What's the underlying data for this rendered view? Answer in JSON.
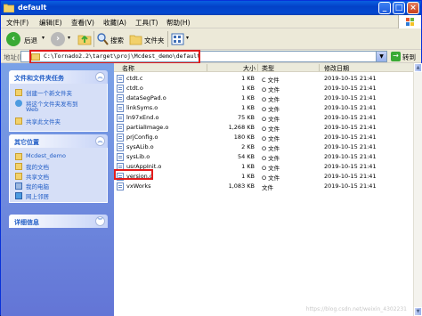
{
  "window": {
    "title": "default"
  },
  "menu": [
    "文件(F)",
    "编辑(E)",
    "查看(V)",
    "收藏(A)",
    "工具(T)",
    "帮助(H)"
  ],
  "toolbar": {
    "back": "后退",
    "search": "搜索",
    "folders": "文件夹"
  },
  "address": {
    "label": "地址(D)",
    "path": "C:\\Tornado2.2\\target\\proj\\Mcdest_demo\\default",
    "go": "转到"
  },
  "tasks": {
    "file_tasks": {
      "header": "文件和文件夹任务",
      "items": [
        "创建一个新文件夹",
        "将这个文件夹发布到",
        "Web",
        "共享此文件夹"
      ]
    },
    "other_places": {
      "header": "其它位置",
      "items": [
        "Mcdest_demo",
        "我的文档",
        "共享文档",
        "我的电脑",
        "网上邻居"
      ]
    },
    "details": {
      "header": "详细信息"
    }
  },
  "columns": {
    "name": "名称",
    "size": "大小",
    "type": "类型",
    "modified": "修改日期"
  },
  "files": [
    {
      "name": "ctdt.c",
      "size": "1 KB",
      "type": "C 文件",
      "modified": "2019-10-15 21:41"
    },
    {
      "name": "ctdt.o",
      "size": "1 KB",
      "type": "O 文件",
      "modified": "2019-10-15 21:41"
    },
    {
      "name": "dataSegPad.o",
      "size": "1 KB",
      "type": "O 文件",
      "modified": "2019-10-15 21:41"
    },
    {
      "name": "linkSyms.o",
      "size": "1 KB",
      "type": "O 文件",
      "modified": "2019-10-15 21:41"
    },
    {
      "name": "ln97xEnd.o",
      "size": "75 KB",
      "type": "O 文件",
      "modified": "2019-10-15 21:41"
    },
    {
      "name": "partialImage.o",
      "size": "1,268 KB",
      "type": "O 文件",
      "modified": "2019-10-15 21:41"
    },
    {
      "name": "prjConfig.o",
      "size": "180 KB",
      "type": "O 文件",
      "modified": "2019-10-15 21:41"
    },
    {
      "name": "sysALib.o",
      "size": "2 KB",
      "type": "O 文件",
      "modified": "2019-10-15 21:41"
    },
    {
      "name": "sysLib.o",
      "size": "54 KB",
      "type": "O 文件",
      "modified": "2019-10-15 21:41"
    },
    {
      "name": "usrAppInit.o",
      "size": "1 KB",
      "type": "O 文件",
      "modified": "2019-10-15 21:41"
    },
    {
      "name": "version.o",
      "size": "1 KB",
      "type": "O 文件",
      "modified": "2019-10-15 21:41"
    },
    {
      "name": "vxWorks",
      "size": "1,083 KB",
      "type": "文件",
      "modified": "2019-10-15 21:41"
    }
  ],
  "watermark": "https://blog.csdn.net/weixin_4302231",
  "colors": {
    "titlebar": "#0A5FE0",
    "sidebar": "#7BA2E7",
    "link": "#215DC6",
    "highlight": "#E21B1B"
  }
}
